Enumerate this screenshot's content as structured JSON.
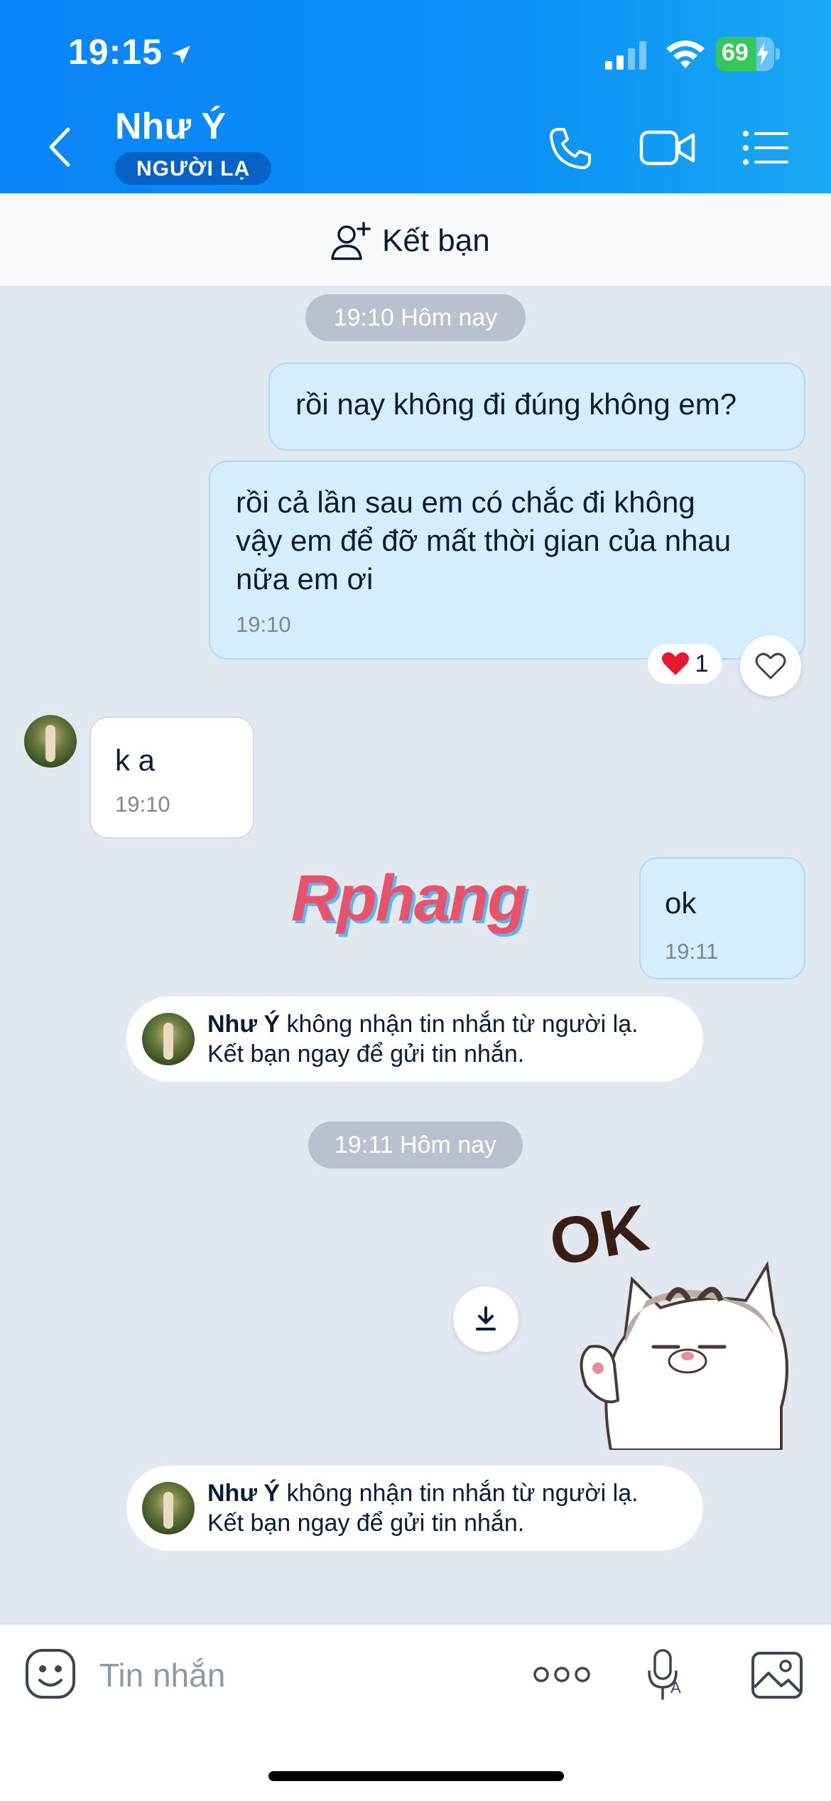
{
  "status_bar": {
    "time": "19:15",
    "battery": "69",
    "battery_level": 0.69
  },
  "header": {
    "contact_name": "Như Ý",
    "badge": "NGƯỜI LẠ",
    "icons": [
      "back-arrow-icon",
      "phone-icon",
      "video-camera-icon",
      "menu-list-icon"
    ]
  },
  "add_friend": {
    "label": "Kết bạn"
  },
  "messages": {
    "pill_1": "19:10 Hôm nay",
    "out_1": "rồi nay không đi đúng không em?",
    "out_2_line1": "rồi cả lần sau em có chắc đi không",
    "out_2_line2": "vậy em để đỡ mất thời gian của nhau",
    "out_2_line3": "nữa em ơi",
    "out_2_time": "19:10",
    "reaction_count": "1",
    "in_1": "k a",
    "in_1_time": "19:10",
    "out_3": "ok",
    "out_3_time": "19:11",
    "pill_2": "19:11 Hôm nay"
  },
  "system_notes": [
    {
      "name": "Như Ý",
      "text1": " không nhận tin nhắn từ người lạ.",
      "text2": "Kết bạn ngay để gửi tin nhắn."
    },
    {
      "name": "Như Ý",
      "text1": " không nhận tin nhắn từ người lạ.",
      "text2": "Kết bạn ngay để gửi tin nhắn."
    }
  ],
  "watermark": "Rphang",
  "sticker_text": "OK",
  "composer": {
    "placeholder": "Tin nhắn"
  },
  "colors": {
    "header": "#0a84f7",
    "bubble_out": "#d4eefd",
    "chat_bg": "#e2e8ef",
    "heart": "#e8172c"
  }
}
